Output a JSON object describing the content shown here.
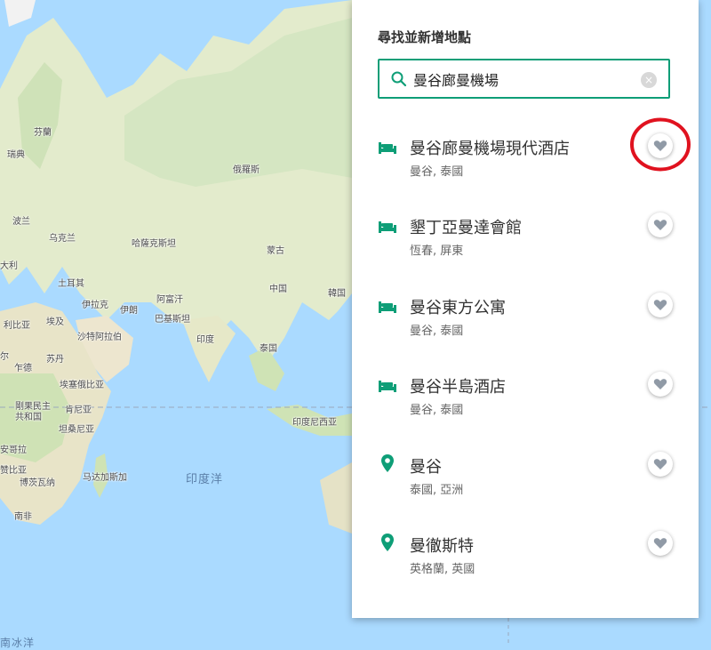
{
  "panel": {
    "title": "尋找並新增地點",
    "search": {
      "value": "曼谷廊曼機場",
      "clear_icon": "×"
    },
    "results": [
      {
        "icon": "hotel-icon",
        "title": "曼谷廊曼機場現代酒店",
        "subtitle": "曼谷, 泰國",
        "favorite_icon": "heart-icon"
      },
      {
        "icon": "hotel-icon",
        "title": "墾丁亞曼達會館",
        "subtitle": "恆春, 屏東",
        "favorite_icon": "heart-icon"
      },
      {
        "icon": "hotel-icon",
        "title": "曼谷東方公寓",
        "subtitle": "曼谷, 泰國",
        "favorite_icon": "heart-icon"
      },
      {
        "icon": "hotel-icon",
        "title": "曼谷半島酒店",
        "subtitle": "曼谷, 泰國",
        "favorite_icon": "heart-icon"
      },
      {
        "icon": "place-pin-icon",
        "title": "曼谷",
        "subtitle": "泰國, 亞洲",
        "favorite_icon": "heart-icon"
      },
      {
        "icon": "place-pin-icon",
        "title": "曼徹斯特",
        "subtitle": "英格蘭, 英國",
        "favorite_icon": "heart-icon"
      }
    ]
  },
  "map": {
    "labels": {
      "finland": "芬蘭",
      "sweden": "瑞典",
      "russia": "俄羅斯",
      "poland": "波兰",
      "ukraine": "乌克兰",
      "italy": "大利",
      "kazakhstan": "哈薩克斯坦",
      "mongolia": "蒙古",
      "turkey": "土耳其",
      "iraq": "伊拉克",
      "iran": "伊朗",
      "afghanistan": "阿富汗",
      "pakistan": "巴基斯坦",
      "china": "中国",
      "korea": "韓国",
      "libya": "利比亚",
      "egypt": "埃及",
      "saudi": "沙特阿拉伯",
      "india": "印度",
      "thailand": "泰国",
      "chad": "尔",
      "sudan": "苏丹",
      "chad2": "乍德",
      "ethiopia": "埃塞俄比亚",
      "drc": "剛果民主\n共和国",
      "kenya": "肯尼亚",
      "tanzania": "坦桑尼亚",
      "indonesia": "印度尼西亚",
      "angola": "安哥拉",
      "zambia": "赞比亚",
      "madagascar": "马达加斯加",
      "botswana": "博茨瓦纳",
      "south_africa": "南非",
      "indian_ocean": "印度洋",
      "south_ocean": "南冰洋"
    }
  },
  "colors": {
    "accent": "#0e9e77",
    "highlight_circle": "#e0121f",
    "ocean": "#aadaff",
    "land": "#dfe9c9"
  }
}
